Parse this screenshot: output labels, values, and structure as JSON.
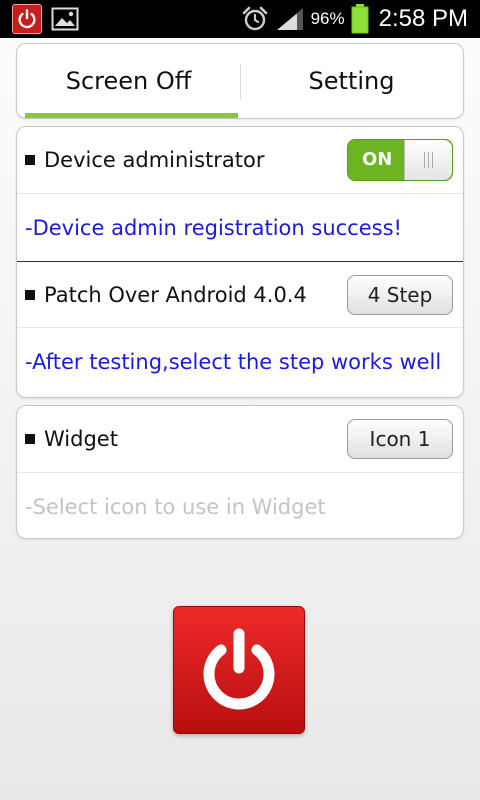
{
  "status_bar": {
    "icons": [
      "power-icon",
      "image-icon",
      "alarm-clock-icon",
      "signal-icon",
      "battery-icon"
    ],
    "battery_percent": "96%",
    "time": "2:58 PM"
  },
  "tabs": [
    {
      "label": "Screen Off",
      "active": true
    },
    {
      "label": "Setting",
      "active": false
    }
  ],
  "settings": {
    "device_admin": {
      "label": "Device administrator",
      "toggle_label": "ON",
      "toggle_state": true,
      "description": "-Device admin registration success!"
    },
    "patch": {
      "label": "Patch Over Android 4.0.4",
      "button_label": "4 Step",
      "description": "-After testing,select the step works well"
    },
    "widget": {
      "label": "Widget",
      "button_label": "Icon 1",
      "description": "-Select icon to use in Widget"
    }
  },
  "colors": {
    "accent_green": "#8bc53f",
    "toggle_green": "#6cb421",
    "link_blue": "#1a1ae0",
    "power_red": "#d81818"
  }
}
